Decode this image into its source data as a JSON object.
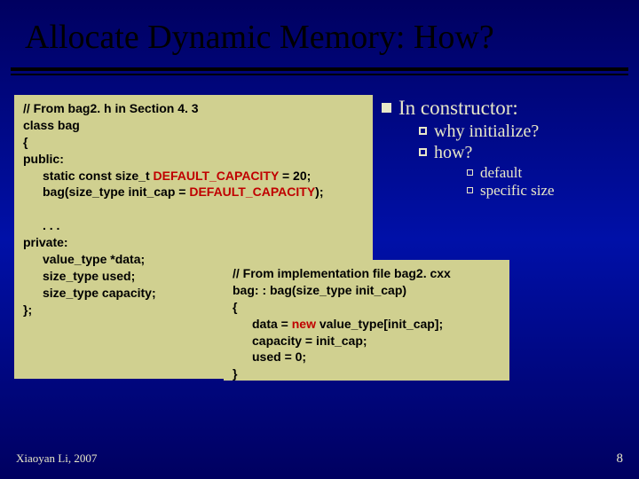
{
  "title": "Allocate Dynamic Memory: How?",
  "code_left": {
    "l1a": "// From  bag2. h in Section 4. 3",
    "l2": "class bag",
    "l3": "{",
    "l4": "public:",
    "l5a": "static const size_t ",
    "l5b": "DEFAULT_CAPACITY",
    "l5c": " = 20;",
    "l6a": "bag(size_type init_cap = ",
    "l6b": "DEFAULT_CAPACITY",
    "l6c": ");",
    "l8": ". . .",
    "l9": "private:",
    "l10": "value_type  *data;",
    "l11": "size_type used;",
    "l12": "size_type  capacity;",
    "l13": "};"
  },
  "code_right": {
    "r1": "// From implementation file bag2. cxx",
    "r2": "bag: : bag(size_type init_cap)",
    "r3": "{",
    "r4a": "data = ",
    "r4b": "new",
    "r4c": " value_type[init_cap];",
    "r5": "capacity = init_cap;",
    "r6": "used = 0;",
    "r7": "}"
  },
  "bullets": {
    "b1": "In constructor:",
    "b2a": "why initialize?",
    "b2b": "how?",
    "b3a": "default",
    "b3b": "specific size"
  },
  "footer": {
    "author": "Xiaoyan Li, 2007",
    "page": "8"
  }
}
